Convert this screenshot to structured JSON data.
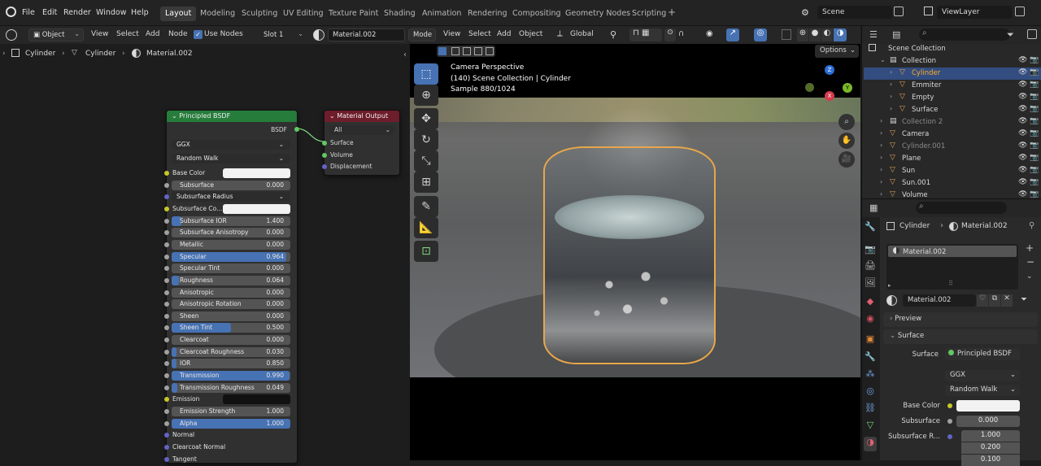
{
  "topbar": {
    "menu": [
      "File",
      "Edit",
      "Render",
      "Window",
      "Help"
    ],
    "workspaces": [
      "Layout",
      "Modeling",
      "Sculpting",
      "UV Editing",
      "Texture Paint",
      "Shading",
      "Animation",
      "Rendering",
      "Compositing",
      "Geometry Nodes",
      "Scripting"
    ],
    "active_workspace": "Layout",
    "add_tab": "+",
    "scene": "Scene",
    "view_layer": "ViewLayer"
  },
  "node_editor": {
    "header": {
      "mode": "Object",
      "menus": [
        "View",
        "Select",
        "Add",
        "Node"
      ],
      "use_nodes_label": "Use Nodes",
      "slot": "Slot 1",
      "material": "Material.002"
    },
    "breadcrumb": [
      "Cylinder",
      "Cylinder",
      "Material.002"
    ],
    "principled": {
      "title": "Principled BSDF",
      "output": "BSDF",
      "distribution": "GGX",
      "subsurface_method": "Random Walk",
      "inputs": [
        {
          "label": "Base Color",
          "kind": "color",
          "color": "#f2f2f2",
          "socket": "#c7c729"
        },
        {
          "label": "Subsurface",
          "kind": "num",
          "value": "0.000",
          "fill": 0,
          "socket": "#a1a1a1"
        },
        {
          "label": "Subsurface Radius",
          "kind": "dd",
          "socket": "#6363c7"
        },
        {
          "label": "Subsurface Co...",
          "kind": "color",
          "color": "#f2f2f2",
          "socket": "#c7c729"
        },
        {
          "label": "Subsurface IOR",
          "kind": "num",
          "value": "1.400",
          "fill": 0.08,
          "socket": "#a1a1a1"
        },
        {
          "label": "Subsurface Anisotropy",
          "kind": "num",
          "value": "0.000",
          "fill": 0,
          "socket": "#a1a1a1"
        },
        {
          "label": "Metallic",
          "kind": "num",
          "value": "0.000",
          "fill": 0,
          "socket": "#a1a1a1"
        },
        {
          "label": "Specular",
          "kind": "num",
          "value": "0.964",
          "fill": 0.964,
          "socket": "#a1a1a1"
        },
        {
          "label": "Specular Tint",
          "kind": "num",
          "value": "0.000",
          "fill": 0,
          "socket": "#a1a1a1"
        },
        {
          "label": "Roughness",
          "kind": "num",
          "value": "0.064",
          "fill": 0.064,
          "socket": "#a1a1a1"
        },
        {
          "label": "Anisotropic",
          "kind": "num",
          "value": "0.000",
          "fill": 0,
          "socket": "#a1a1a1"
        },
        {
          "label": "Anisotropic Rotation",
          "kind": "num",
          "value": "0.000",
          "fill": 0,
          "socket": "#a1a1a1"
        },
        {
          "label": "Sheen",
          "kind": "num",
          "value": "0.000",
          "fill": 0,
          "socket": "#a1a1a1"
        },
        {
          "label": "Sheen Tint",
          "kind": "num",
          "value": "0.500",
          "fill": 0.5,
          "socket": "#a1a1a1"
        },
        {
          "label": "Clearcoat",
          "kind": "num",
          "value": "0.000",
          "fill": 0,
          "socket": "#a1a1a1"
        },
        {
          "label": "Clearcoat Roughness",
          "kind": "num",
          "value": "0.030",
          "fill": 0.03,
          "socket": "#a1a1a1"
        },
        {
          "label": "IOR",
          "kind": "num",
          "value": "0.850",
          "fill": 0.03,
          "socket": "#a1a1a1"
        },
        {
          "label": "Transmission",
          "kind": "num",
          "value": "0.990",
          "fill": 0.99,
          "socket": "#a1a1a1"
        },
        {
          "label": "Transmission Roughness",
          "kind": "num",
          "value": "0.049",
          "fill": 0.049,
          "socket": "#a1a1a1"
        },
        {
          "label": "Emission",
          "kind": "color",
          "color": "#111111",
          "socket": "#c7c729"
        },
        {
          "label": "Emission Strength",
          "kind": "num",
          "value": "1.000",
          "fill": 0,
          "socket": "#a1a1a1"
        },
        {
          "label": "Alpha",
          "kind": "num",
          "value": "1.000",
          "fill": 1,
          "socket": "#a1a1a1"
        },
        {
          "label": "Normal",
          "kind": "plain",
          "socket": "#6363c7"
        },
        {
          "label": "Clearcoat Normal",
          "kind": "plain",
          "socket": "#6363c7"
        },
        {
          "label": "Tangent",
          "kind": "plain",
          "socket": "#6363c7"
        }
      ]
    },
    "output_node": {
      "title": "Material Output",
      "target": "All",
      "sockets": [
        "Surface",
        "Volume",
        "Displacement"
      ]
    }
  },
  "viewport": {
    "header": {
      "mode": "Mode",
      "menus": [
        "View",
        "Select",
        "Add",
        "Object"
      ],
      "transform": "Global",
      "options": "Options"
    },
    "overlay": {
      "line1": "Camera Perspective",
      "line2": "(140) Scene Collection | Cylinder",
      "line3": "Sample 880/1024"
    },
    "gizmo": {
      "z": "Z",
      "y": "Y",
      "x": "X"
    }
  },
  "outliner": {
    "root": "Scene Collection",
    "rows": [
      {
        "label": "Collection",
        "indent": 1,
        "dim": false,
        "active": false
      },
      {
        "label": "Cylinder",
        "indent": 2,
        "dim": false,
        "active": true
      },
      {
        "label": "Emmiter",
        "indent": 2,
        "dim": false,
        "active": false
      },
      {
        "label": "Empty",
        "indent": 2,
        "dim": false,
        "active": false
      },
      {
        "label": "Surface",
        "indent": 2,
        "dim": false,
        "active": false
      },
      {
        "label": "Collection 2",
        "indent": 1,
        "dim": true,
        "active": false
      },
      {
        "label": "Camera",
        "indent": 1,
        "dim": false,
        "active": false
      },
      {
        "label": "Cylinder.001",
        "indent": 1,
        "dim": true,
        "active": false
      },
      {
        "label": "Plane",
        "indent": 1,
        "dim": false,
        "active": false
      },
      {
        "label": "Sun",
        "indent": 1,
        "dim": false,
        "active": false
      },
      {
        "label": "Sun.001",
        "indent": 1,
        "dim": false,
        "active": false
      },
      {
        "label": "Volume",
        "indent": 1,
        "dim": false,
        "active": false
      }
    ]
  },
  "properties": {
    "breadcrumb_object": "Cylinder",
    "breadcrumb_material": "Material.002",
    "slot_item": "Material.002",
    "material_name": "Material.002",
    "preview_label": "Preview",
    "surface_label": "Surface",
    "surface_field_label": "Surface",
    "surface_shader": "Principled BSDF",
    "distribution": "GGX",
    "subsurface_method": "Random Walk",
    "base_color_label": "Base Color",
    "subsurface_label": "Subsurface",
    "subsurface_value": "0.000",
    "subsurface_r_label": "Subsurface R...",
    "radius": [
      "1.000",
      "0.200",
      "0.100"
    ]
  }
}
